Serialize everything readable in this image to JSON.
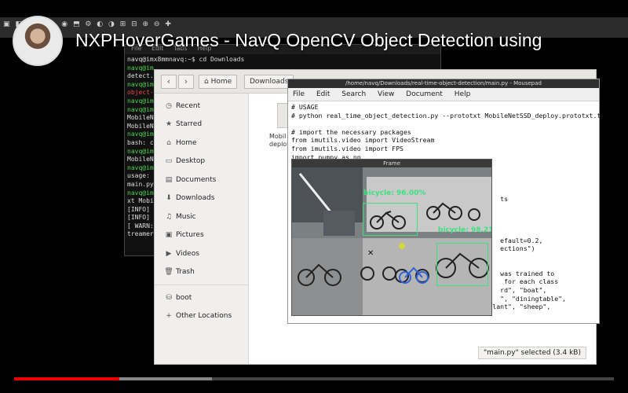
{
  "video": {
    "title": "NXPHoverGames - NavQ OpenCV Object Detection using",
    "progress_played": 0.175,
    "progress_buffered": 0.33,
    "accent": "#ee0000"
  },
  "terminal": {
    "menu": [
      "File",
      "Edit",
      "Tabs",
      "Help"
    ],
    "lines": [
      {
        "text": "navq@imx8mmnavq:~$ cd Downloads",
        "cls": ""
      },
      {
        "text": "navq@im",
        "cls": "g"
      },
      {
        "text": "detect.",
        "cls": ""
      },
      {
        "text": "navq@im",
        "cls": "g"
      },
      {
        "text": "object-",
        "cls": "r"
      },
      {
        "text": "navq@im",
        "cls": "g"
      },
      {
        "text": "navq@im",
        "cls": "g"
      },
      {
        "text": "MobileN",
        "cls": ""
      },
      {
        "text": "MobileN",
        "cls": ""
      },
      {
        "text": "navq@im",
        "cls": "g"
      },
      {
        "text": "bash: c",
        "cls": ""
      },
      {
        "text": "navq@im",
        "cls": "g"
      },
      {
        "text": "MobileN",
        "cls": ""
      },
      {
        "text": "navq@im",
        "cls": "g"
      },
      {
        "text": "usage: ",
        "cls": ""
      },
      {
        "text": "main.py",
        "cls": ""
      },
      {
        "text": "navq@im",
        "cls": "g"
      },
      {
        "text": "xt Mobi",
        "cls": ""
      },
      {
        "text": "[INFO] ",
        "cls": ""
      },
      {
        "text": "[INFO] ",
        "cls": ""
      },
      {
        "text": "[ WARN:",
        "cls": ""
      },
      {
        "text": "treamer",
        "cls": ""
      }
    ]
  },
  "filemanager": {
    "nav_back": "‹",
    "nav_forward": "›",
    "breadcrumbs": [
      "Home",
      "Downloads"
    ],
    "sidebar": [
      {
        "label": "Recent",
        "icon": "clock-icon",
        "glyph": "◷"
      },
      {
        "label": "Starred",
        "icon": "star-icon",
        "glyph": "★"
      },
      {
        "label": "Home",
        "icon": "home-icon",
        "glyph": "⌂"
      },
      {
        "label": "Desktop",
        "icon": "desktop-icon",
        "glyph": "▭"
      },
      {
        "label": "Documents",
        "icon": "documents-icon",
        "glyph": "▤"
      },
      {
        "label": "Downloads",
        "icon": "download-icon",
        "glyph": "⬇"
      },
      {
        "label": "Music",
        "icon": "music-icon",
        "glyph": "♫"
      },
      {
        "label": "Pictures",
        "icon": "pictures-icon",
        "glyph": "▣"
      },
      {
        "label": "Videos",
        "icon": "videos-icon",
        "glyph": "▶"
      },
      {
        "label": "Trash",
        "icon": "trash-icon",
        "glyph": "🗑"
      }
    ],
    "devices": [
      {
        "label": "boot",
        "icon": "drive-icon",
        "glyph": "⛁"
      },
      {
        "label": "Other Locations",
        "icon": "plus-icon",
        "glyph": "+"
      }
    ],
    "file_label_1": "Mobil",
    "file_label_2": "deploy.",
    "status": "\"main.py\" selected (3.4 kB)"
  },
  "editor": {
    "title": "/home/navq/Downloads/real-time-object-detection/main.py - Mousepad",
    "menu": [
      "File",
      "Edit",
      "Search",
      "View",
      "Document",
      "Help"
    ],
    "code": [
      "# USAGE",
      "# python real_time_object_detection.py --prototxt MobileNetSSD_deploy.prototxt.t",
      "",
      "# import the necessary packages",
      "from imutils.video import VideoStream",
      "from imutils.video import FPS",
      "import numpy as np",
      "",
      "",
      "",
      "",
      "                                                      ts",
      "",
      "",
      "",
      "",
      "                                                      efault=0.2,",
      "                                                      ections\")",
      "",
      "",
      "                                                      was trained to",
      "                                                       for each class",
      "                                                      rd\", \"boat\",",
      "                                                      \", \"diningtable\",",
      "     \"dog\", \"horse\", \"motorbike\", \"person\", \"pottedplant\", \"sheep\","
    ]
  },
  "frame": {
    "title": "Frame",
    "detections": [
      {
        "label": "bicycle: 96.00%"
      },
      {
        "label": "bicycle: 98.21"
      }
    ]
  }
}
